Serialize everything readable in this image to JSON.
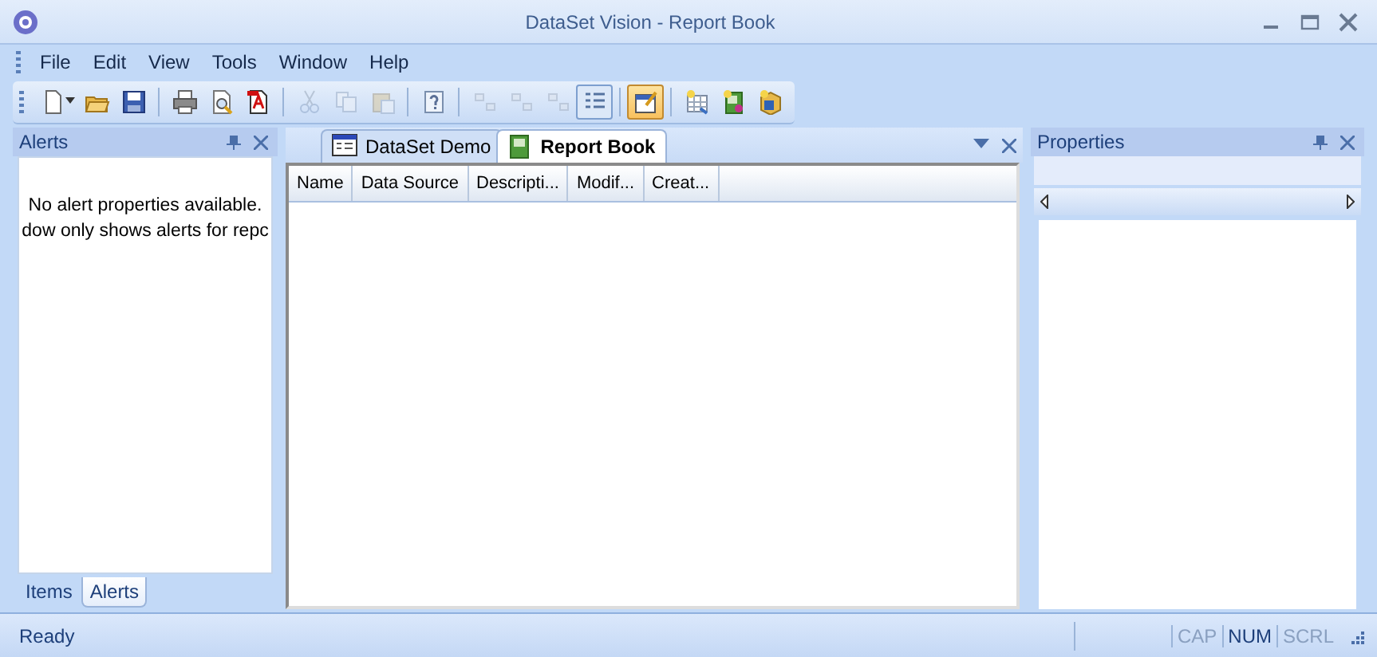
{
  "window": {
    "title": "DataSet Vision - Report Book"
  },
  "menu": [
    "File",
    "Edit",
    "View",
    "Tools",
    "Window",
    "Help"
  ],
  "toolbar": [
    [
      {
        "kind": "new",
        "disabled": false,
        "pressed": false
      },
      {
        "kind": "open",
        "disabled": false,
        "pressed": false
      },
      {
        "kind": "save",
        "disabled": false,
        "pressed": false
      }
    ],
    [
      {
        "kind": "print",
        "disabled": false,
        "pressed": false
      },
      {
        "kind": "preview",
        "disabled": false,
        "pressed": false
      },
      {
        "kind": "pdf",
        "disabled": false,
        "pressed": false
      }
    ],
    [
      {
        "kind": "cut",
        "disabled": true,
        "pressed": false
      },
      {
        "kind": "copy",
        "disabled": true,
        "pressed": false
      },
      {
        "kind": "paste",
        "disabled": true,
        "pressed": false
      }
    ],
    [
      {
        "kind": "help",
        "disabled": false,
        "pressed": false
      }
    ],
    [
      {
        "kind": "tile",
        "disabled": true,
        "pressed": false
      },
      {
        "kind": "tile",
        "disabled": true,
        "pressed": false
      },
      {
        "kind": "tile",
        "disabled": true,
        "pressed": false
      },
      {
        "kind": "list",
        "disabled": false,
        "pressed": true
      }
    ],
    [
      {
        "kind": "properties",
        "disabled": false,
        "pressed": true
      }
    ],
    [
      {
        "kind": "grid",
        "disabled": false,
        "pressed": false
      },
      {
        "kind": "book",
        "disabled": false,
        "pressed": false
      },
      {
        "kind": "box",
        "disabled": false,
        "pressed": false
      }
    ]
  ],
  "alerts_panel": {
    "title": "Alerts",
    "message_lines": [
      "No alert properties available.",
      "dow only shows alerts for repc"
    ],
    "tabs": [
      {
        "label": "Items",
        "selected": false
      },
      {
        "label": "Alerts",
        "selected": true
      }
    ]
  },
  "document": {
    "tabs": [
      {
        "label": "DataSet Demo",
        "selected": false
      },
      {
        "label": "Report Book",
        "selected": true
      }
    ],
    "columns": [
      "Name",
      "Data Source",
      "Descripti...",
      "Modif...",
      "Creat..."
    ]
  },
  "properties_panel": {
    "title": "Properties"
  },
  "status_bar": {
    "text": "Ready",
    "indicators": [
      {
        "label": "CAP",
        "on": false
      },
      {
        "label": "NUM",
        "on": true
      },
      {
        "label": "SCRL",
        "on": false
      }
    ]
  }
}
